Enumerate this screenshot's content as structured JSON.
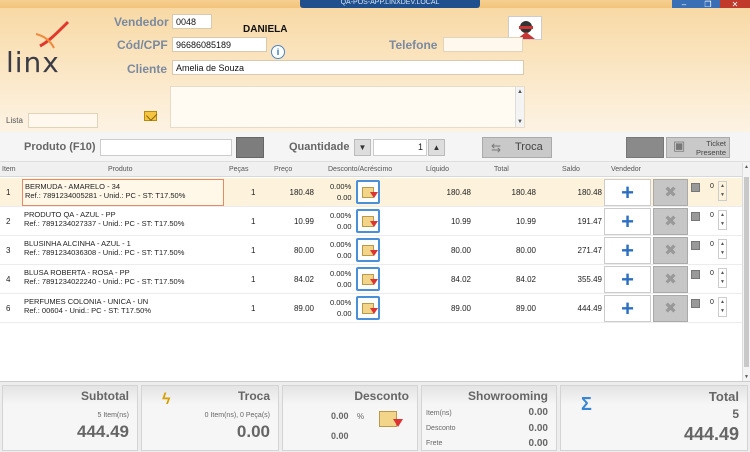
{
  "window": {
    "title": "QA-POS-APP.LINXDEV.LOCAL",
    "min": "–",
    "max": "❐",
    "close": "✕"
  },
  "header": {
    "logo": "linx",
    "vendedor_label": "Vendedor",
    "vendedor_code": "0048",
    "vendedor_name": "DANIELA",
    "cpf_label": "Cód/CPF",
    "cpf_value": "96686085189",
    "telefone_label": "Telefone",
    "telefone_value": "",
    "cliente_label": "Cliente",
    "cliente_value": "Amelia de Souza",
    "lista_label": "Lista",
    "lista_value": ""
  },
  "product_bar": {
    "produto_label": "Produto (F10)",
    "produto_value": "",
    "quantidade_label": "Quantidade",
    "quantidade_value": "1",
    "troca_label": "Troca",
    "ticket_label_1": "Ticket",
    "ticket_label_2": "Presente"
  },
  "table": {
    "headers": {
      "item": "Item",
      "produto": "Produto",
      "pecas": "Peças",
      "preco": "Preço",
      "desconto": "Desconto/Acréscimo",
      "liquido": "Líquido",
      "total": "Total",
      "saldo": "Saldo",
      "vendedor": "Vendedor"
    },
    "rows": [
      {
        "item": "1",
        "name": "BERMUDA - AMARELO - 34",
        "ref": "Ref.: 7891234005281 - Unid.: PC - ST: T17.50%",
        "pecas": "1",
        "preco": "180.48",
        "desc_pct": "0.00%",
        "desc_val": "0.00",
        "liquido": "180.48",
        "total": "180.48",
        "saldo": "180.48",
        "mini": "0"
      },
      {
        "item": "2",
        "name": "PRODUTO QA - AZUL - PP",
        "ref": "Ref.: 7891234027337 - Unid.: PC - ST: T17.50%",
        "pecas": "1",
        "preco": "10.99",
        "desc_pct": "0.00%",
        "desc_val": "0.00",
        "liquido": "10.99",
        "total": "10.99",
        "saldo": "191.47",
        "mini": "0"
      },
      {
        "item": "3",
        "name": "BLUSINHA ALCINHA - AZUL - 1",
        "ref": "Ref.: 7891234036308 - Unid.: PC - ST: T17.50%",
        "pecas": "1",
        "preco": "80.00",
        "desc_pct": "0.00%",
        "desc_val": "0.00",
        "liquido": "80.00",
        "total": "80.00",
        "saldo": "271.47",
        "mini": "0"
      },
      {
        "item": "4",
        "name": "BLUSA ROBERTA - ROSA - PP",
        "ref": "Ref.: 7891234022240 - Unid.: PC - ST: T17.50%",
        "pecas": "1",
        "preco": "84.02",
        "desc_pct": "0.00%",
        "desc_val": "0.00",
        "liquido": "84.02",
        "total": "84.02",
        "saldo": "355.49",
        "mini": "0"
      },
      {
        "item": "6",
        "name": "PERFUMES COLONIA - UNICA - UN",
        "ref": "Ref.: 00604 - Unid.: PC - ST: T17.50%",
        "pecas": "1",
        "preco": "89.00",
        "desc_pct": "0.00%",
        "desc_val": "0.00",
        "liquido": "89.00",
        "total": "89.00",
        "saldo": "444.49",
        "mini": "0"
      }
    ]
  },
  "footer": {
    "subtotal": {
      "title": "Subtotal",
      "sub": "5 Item(ns)",
      "value": "444.49"
    },
    "troca": {
      "title": "Troca",
      "sub": "0 Item(ns), 0 Peça(s)",
      "value": "0.00"
    },
    "desconto": {
      "title": "Desconto",
      "pct": "0.00",
      "pct_sign": "%",
      "value": "0.00"
    },
    "showrooming": {
      "title": "Showrooming",
      "item_label": "Item(ns)",
      "item_value": "0.00",
      "desconto_label": "Desconto",
      "desconto_value": "0.00",
      "frete_label": "Frete",
      "frete_value": "0.00"
    },
    "total": {
      "title": "Total",
      "count": "5",
      "value": "444.49"
    }
  },
  "colors": {
    "accent_blue": "#2d6fc0",
    "header_orange": "#f8d9a5",
    "logo_red": "#e2382b"
  }
}
